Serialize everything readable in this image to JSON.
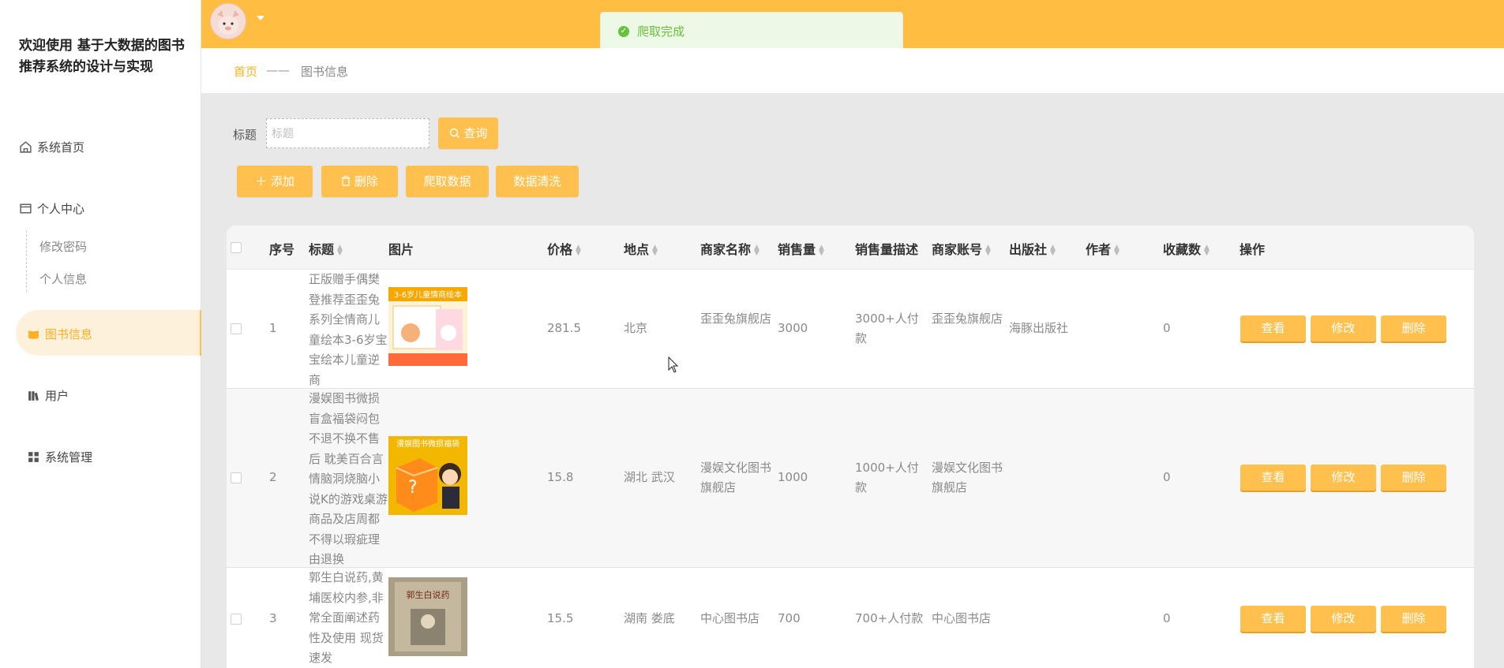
{
  "sidebar": {
    "app_title": "欢迎使用 基于大数据的图书推荐系统的设计与实现",
    "items": [
      {
        "label": "系统首页",
        "icon": "home-icon"
      },
      {
        "label": "个人中心",
        "icon": "profile-icon"
      },
      {
        "label": "修改密码"
      },
      {
        "label": "个人信息"
      },
      {
        "label": "图书信息",
        "icon": "book-icon",
        "active": true
      },
      {
        "label": "用户",
        "icon": "user-icon"
      },
      {
        "label": "系统管理",
        "icon": "grid-icon"
      }
    ]
  },
  "header": {
    "toast": "爬取完成"
  },
  "breadcrumb": {
    "home": "首页",
    "separator": "——",
    "current": "图书信息"
  },
  "search": {
    "label": "标题",
    "placeholder": "标题",
    "query_button": "查询"
  },
  "actions": {
    "add": "添加",
    "delete": "删除",
    "crawl": "爬取数据",
    "clean": "数据清洗"
  },
  "table": {
    "columns": [
      "序号",
      "标题",
      "图片",
      "价格",
      "地点",
      "商家名称",
      "销售量",
      "销售量描述",
      "商家账号",
      "出版社",
      "作者",
      "收藏数",
      "操作"
    ],
    "rows": [
      {
        "index": "1",
        "title": "正版赠手偶樊登推荐歪歪兔系列全情商儿童绘本3-6岁宝宝绘本儿童逆商",
        "image_caption": "3-6岁儿童情商绘本",
        "price": "281.5",
        "location": "北京",
        "merchant": "歪歪兔旗舰店",
        "sales": "3000",
        "sales_desc": "3000+人付款",
        "account": "歪歪兔旗舰店",
        "publisher": "海豚出版社",
        "author": "",
        "favorites": "0"
      },
      {
        "index": "2",
        "title": "漫娱图书微损盲盒福袋闷包不退不换不售后 耽美百合言情脑洞烧脑小说K的游戏桌游 商品及店周都不得以瑕疵理由退换",
        "image_caption": "漫娱图书微损福袋",
        "price": "15.8",
        "location": "湖北 武汉",
        "merchant": "漫娱文化图书旗舰店",
        "sales": "1000",
        "sales_desc": "1000+人付款",
        "account": "漫娱文化图书旗舰店",
        "publisher": "",
        "author": "",
        "favorites": "0"
      },
      {
        "index": "3",
        "title": "郭生白说药,黄埔医校内参,非常全面阐述药性及使用 现货速发",
        "image_caption": "郭生白说药",
        "price": "15.5",
        "location": "湖南 娄底",
        "merchant": "中心图书店",
        "sales": "700",
        "sales_desc": "700+人付款",
        "account": "中心图书店",
        "publisher": "",
        "author": "",
        "favorites": "0"
      }
    ],
    "op_view": "查看",
    "op_edit": "修改",
    "op_delete": "删除"
  },
  "colors": {
    "accent": "#ffbd42",
    "success": "#67c23a"
  }
}
